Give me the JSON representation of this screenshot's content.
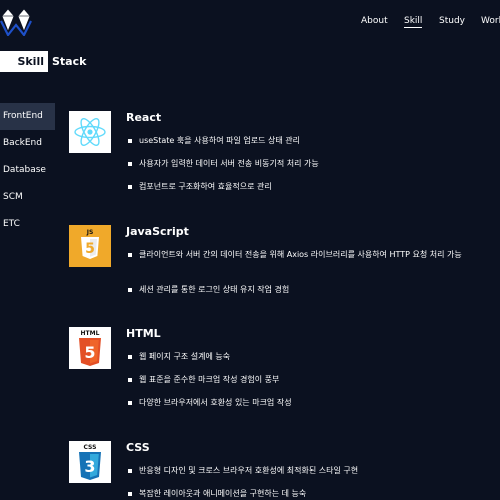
{
  "nav": {
    "items": [
      {
        "label": "About"
      },
      {
        "label": "Skill",
        "active": true
      },
      {
        "label": "Study"
      },
      {
        "label": "Work"
      }
    ]
  },
  "page_title": {
    "highlight": "Skill",
    "rest": "Stack"
  },
  "sidebar": {
    "items": [
      {
        "label": "FrontEnd",
        "active": true
      },
      {
        "label": "BackEnd"
      },
      {
        "label": "Database"
      },
      {
        "label": "SCM"
      },
      {
        "label": "ETC"
      }
    ]
  },
  "skills": [
    {
      "name": "React",
      "icon": "react-icon",
      "bullets": [
        "useState 훅을 사용하여 파일 업로드 상태 관리",
        "사용자가 입력한 데이터 서버 전송 비동기적 처리 가능",
        "컴포넌트로 구조화하여 효율적으로 관리"
      ]
    },
    {
      "name": "JavaScript",
      "icon": "javascript-icon",
      "icon_label": "JS",
      "bullets": [
        "클라이언트와 서버 간의 데이터 전송을 위해 Axios 라이브러리를 사용하여 HTTP 요청 처리 가능",
        "세션 관리를 통한 로그인 상태 유지 작업 경험"
      ]
    },
    {
      "name": "HTML",
      "icon": "html5-icon",
      "icon_label": "HTML",
      "bullets": [
        "웹 페이지 구조 설계에 능숙",
        "웹 표준을 준수한 마크업 작성 경험이 풍부",
        "다양한 브라우저에서 호환성 있는 마크업 작성"
      ]
    },
    {
      "name": "CSS",
      "icon": "css3-icon",
      "icon_label": "CSS",
      "bullets": [
        "반응형 디자인 및 크로스 브라우저 호환성에 최적화된 스타일 구현",
        "복잡한 레이아웃과 애니메이션을 구현하는 데 능숙"
      ]
    }
  ],
  "colors": {
    "background": "#0b1120",
    "sidebar_active": "#283247",
    "react": "#61dafb",
    "javascript": "#f0a92a",
    "html": "#e34f26",
    "css": "#1572b6"
  }
}
